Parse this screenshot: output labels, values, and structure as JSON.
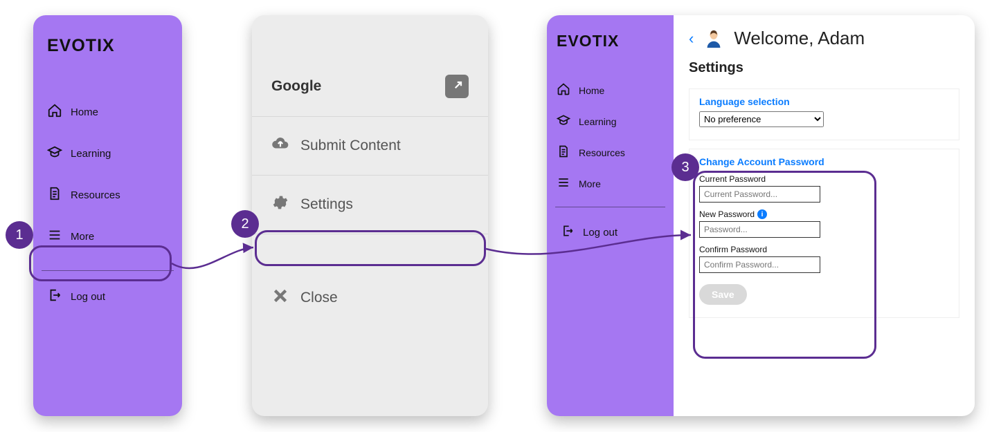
{
  "brand": "EVOTIX",
  "steps": {
    "one": "1",
    "two": "2",
    "three": "3"
  },
  "panel1": {
    "nav": {
      "home": "Home",
      "learning": "Learning",
      "resources": "Resources",
      "more": "More",
      "logout": "Log out"
    }
  },
  "panel2": {
    "google": "Google",
    "submit": "Submit Content",
    "settings": "Settings",
    "close": "Close"
  },
  "panel3": {
    "nav": {
      "home": "Home",
      "learning": "Learning",
      "resources": "Resources",
      "more": "More",
      "logout": "Log out"
    },
    "welcome": "Welcome, Adam",
    "settings_title": "Settings",
    "lang": {
      "heading": "Language selection",
      "selected": "No preference"
    },
    "pwd": {
      "heading": "Change Account Password",
      "current_label": "Current Password",
      "current_ph": "Current Password...",
      "new_label": "New Password",
      "new_ph": "Password...",
      "confirm_label": "Confirm Password",
      "confirm_ph": "Confirm Password...",
      "save": "Save"
    }
  }
}
